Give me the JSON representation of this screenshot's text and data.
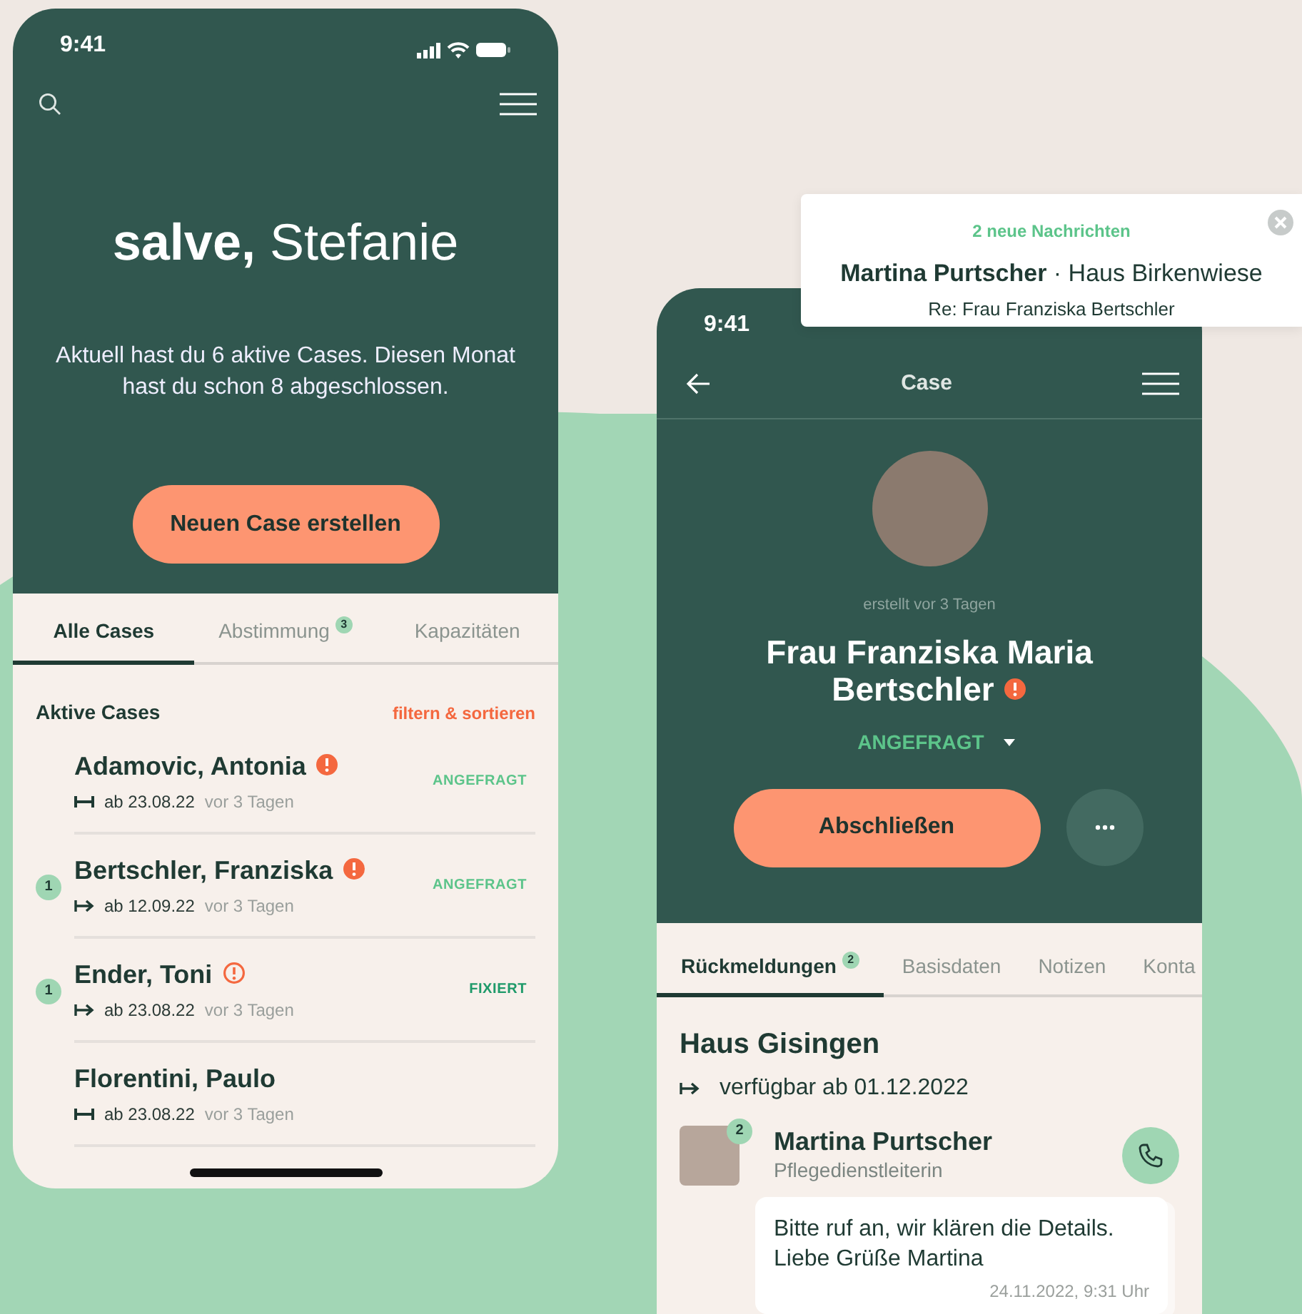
{
  "home_screen": {
    "status_bar": {
      "time": "9:41"
    },
    "greeting": "**salve,** Stefanie",
    "summary": "Aktuell hast du 6 aktive Cases. Diesen Monat hast du schon 8 abgeschlossen.",
    "create_button": "Neuen Case erstellen",
    "tabs": [
      {
        "label": "Alle Cases",
        "selected": true
      },
      {
        "label": "Abstimmung",
        "badge": "3",
        "selected": false
      },
      {
        "label": "Kapazitäten",
        "selected": false
      }
    ],
    "section_title": "Aktive Cases",
    "filter_link": "filtern & sortieren",
    "cases": [
      {
        "name": "Adamovic, Antonia",
        "alert": {
          "kind": "filled"
        },
        "date": {
          "kind": "range",
          "text": "ab 23.08.22"
        },
        "age": "vor 3 Tagen",
        "status": {
          "text": "ANGEFRAGT",
          "color": "#5cc48a"
        }
      },
      {
        "count": "1",
        "name": "Bertschler, Franziska",
        "alert": {
          "kind": "filled"
        },
        "date": {
          "kind": "arrow",
          "text": "ab 12.09.22"
        },
        "age": "vor 3 Tagen",
        "status": {
          "text": "ANGEFRAGT",
          "color": "#5cc48a"
        }
      },
      {
        "count": "1",
        "name": "Ender, Toni",
        "alert": {
          "kind": "outline"
        },
        "date": {
          "kind": "arrow",
          "text": "ab 23.08.22"
        },
        "age": "vor 3 Tagen",
        "status": {
          "text": "FIXIERT",
          "color": "#1f9a6a"
        }
      },
      {
        "name": "Florentini, Paulo",
        "date": {
          "kind": "range",
          "text": "ab 23.08.22"
        },
        "age": "vor 3 Tagen"
      }
    ]
  },
  "case_screen": {
    "status_bar": {
      "time": "9:41"
    },
    "title": "Case",
    "created": "erstellt vor 3 Tagen",
    "name_lines": [
      "Frau Franziska Maria",
      "Bertschler"
    ],
    "alert": {
      "kind": "filled"
    },
    "status": "ANGEFRAGT",
    "close_button": "Abschließen",
    "tabs": [
      {
        "label": "Rückmeldungen",
        "badge": "2",
        "selected": true
      },
      {
        "label": "Basisdaten",
        "selected": false
      },
      {
        "label": "Notizen",
        "selected": false
      },
      {
        "label": "Konta",
        "selected": false
      }
    ],
    "facility": "Haus Gisingen",
    "availability": "verfügbar ab 01.12.2022",
    "contact": {
      "badge": "2",
      "name": "Martina Purtscher",
      "role": "Pflegedienstleiterin"
    },
    "message": {
      "text": "Bitte ruf an, wir klären die Details. Liebe Grüße Martina",
      "time": "24.11.2022, 9:31 Uhr"
    }
  },
  "notification": {
    "title": "2 neue Nachrichten",
    "sender": "**Martina Purtscher** · Haus Birkenwiese",
    "subject": "Re: Frau Franziska Bertschler"
  }
}
